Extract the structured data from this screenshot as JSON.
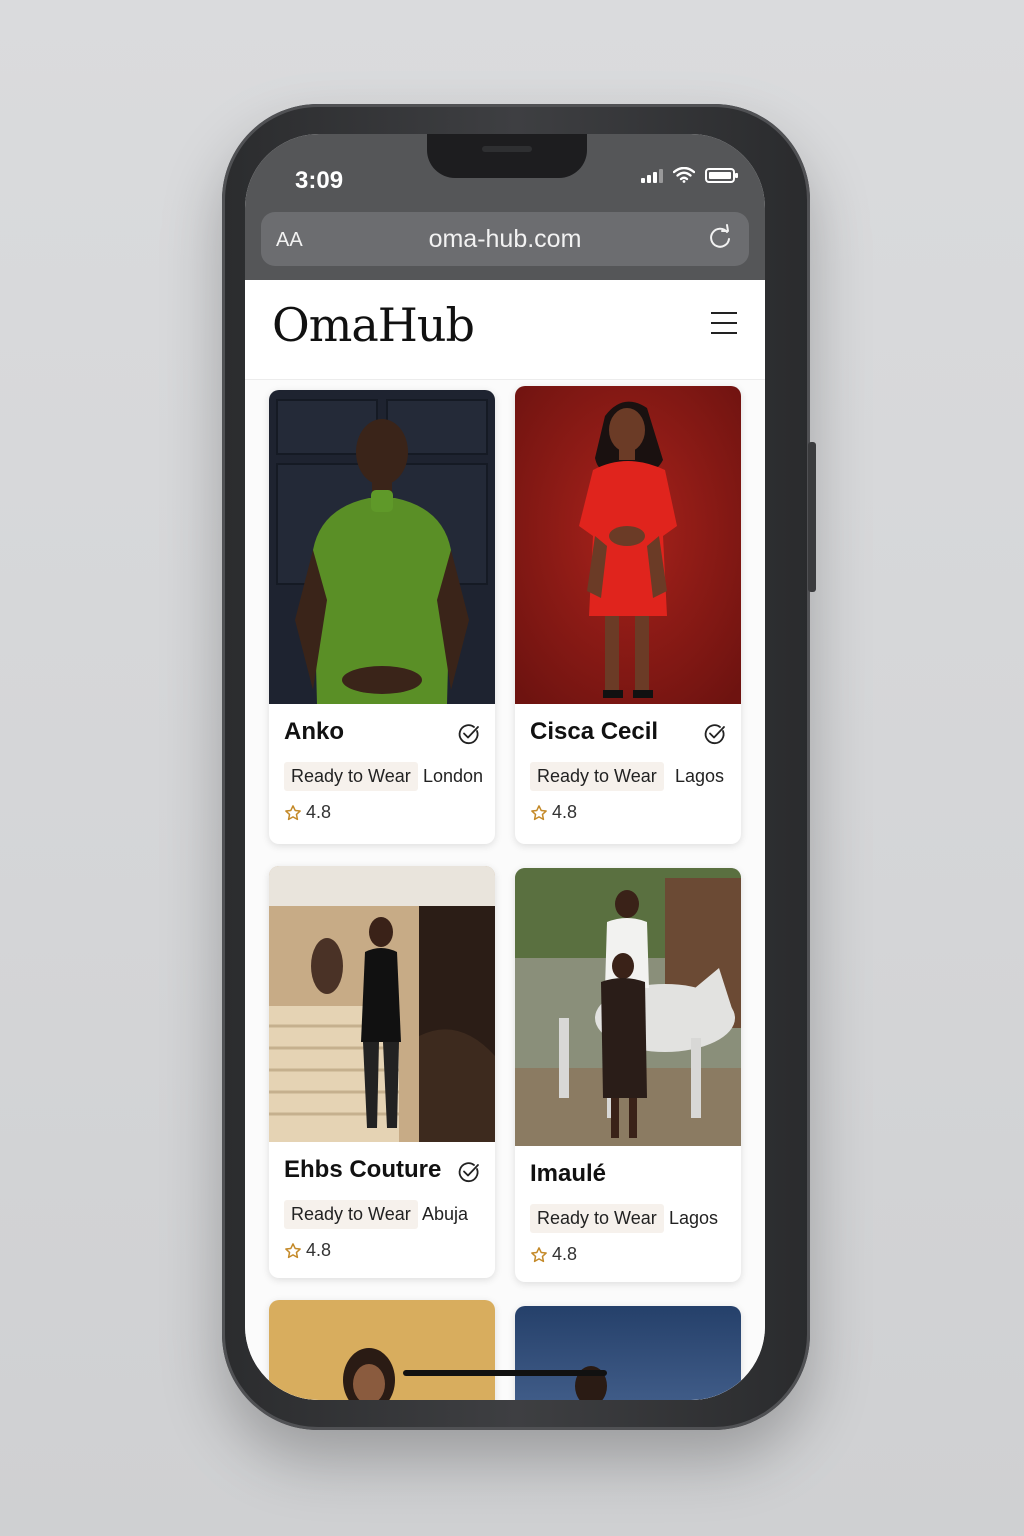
{
  "status_bar": {
    "time": "3:09"
  },
  "browser": {
    "text_size_label": "AA",
    "url": "oma-hub.com",
    "reload_icon": "reload-icon"
  },
  "site": {
    "logo": "OmaHub",
    "menu_icon": "hamburger-menu-icon"
  },
  "designers": [
    {
      "name": "Anko",
      "category": "Ready to Wear",
      "location": "London",
      "rating": "4.8",
      "verified": true
    },
    {
      "name": "Cisca Cecil",
      "category": "Ready to Wear",
      "location": "Lagos",
      "rating": "4.8",
      "verified": true
    },
    {
      "name": "Ehbs Couture",
      "category": "Ready to Wear",
      "location": "Abuja",
      "rating": "4.8",
      "verified": true
    },
    {
      "name": "Imaulé",
      "category": "Ready to Wear",
      "location": "Lagos",
      "rating": "4.8",
      "verified": false
    }
  ],
  "colors": {
    "accent_star": "#c48a2a",
    "chrome": "#555658",
    "tag_bg": "#f6f1ec"
  }
}
